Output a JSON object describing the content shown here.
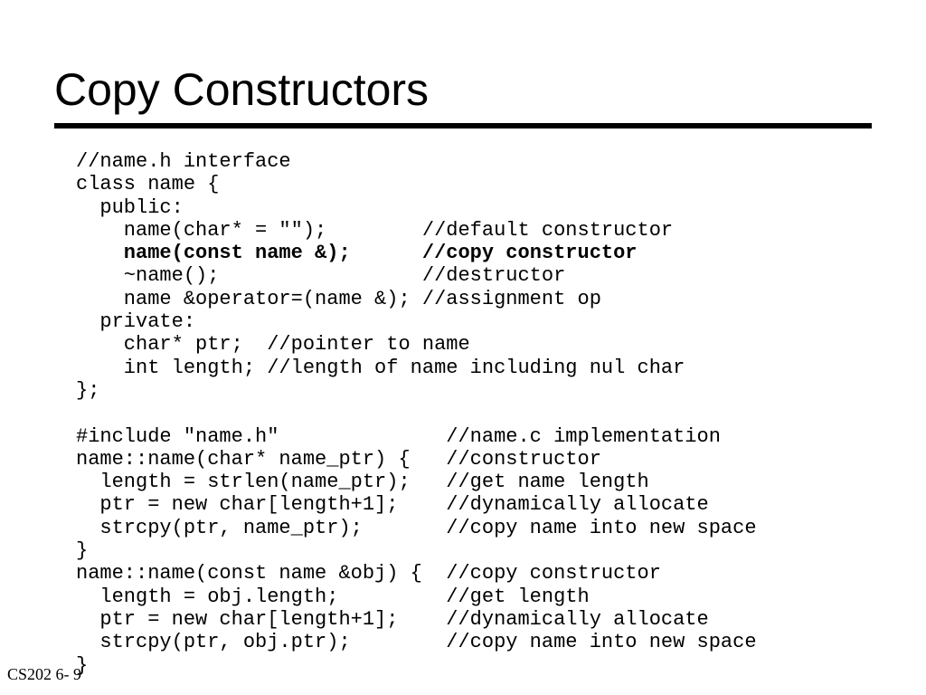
{
  "title": "Copy Constructors",
  "footer": "CS202 6- 9",
  "code": {
    "l01": "//name.h interface",
    "l02": "class name {",
    "l03": "  public:",
    "l04": "    name(char* = \"\");        //default constructor",
    "l05a": "    name(const name &);",
    "l05b": "      //copy constructor",
    "l06": "    ~name();                 //destructor",
    "l07": "    name &operator=(name &); //assignment op",
    "l08": "  private:",
    "l09": "    char* ptr;  //pointer to name",
    "l10": "    int length; //length of name including nul char",
    "l11": "};",
    "l12": "",
    "l13": "#include \"name.h\"              //name.c implementation",
    "l14": "name::name(char* name_ptr) {   //constructor",
    "l15": "  length = strlen(name_ptr);   //get name length",
    "l16": "  ptr = new char[length+1];    //dynamically allocate",
    "l17": "  strcpy(ptr, name_ptr);       //copy name into new space",
    "l18": "}",
    "l19": "name::name(const name &obj) {  //copy constructor",
    "l20": "  length = obj.length;         //get length",
    "l21": "  ptr = new char[length+1];    //dynamically allocate",
    "l22": "  strcpy(ptr, obj.ptr);        //copy name into new space",
    "l23": "}"
  }
}
